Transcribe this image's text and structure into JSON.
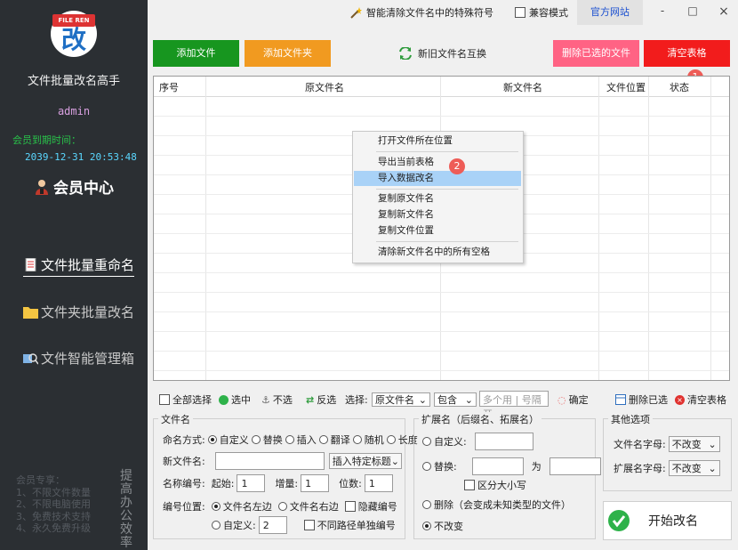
{
  "sidebar": {
    "logo_badge": "FILE REN",
    "logo_char": "改",
    "app_title": "文件批量改名高手",
    "username": "admin",
    "expiry_label": "会员到期时间：",
    "expiry_date": "2039-12-31 20:53:48",
    "vip_center": "会员中心",
    "nav": [
      {
        "label": "文件批量重命名",
        "icon": "document-icon"
      },
      {
        "label": "文件夹批量改名",
        "icon": "folder-icon"
      },
      {
        "label": "文件智能管理箱",
        "icon": "search-files-icon"
      }
    ],
    "vip_title": "会员专享：",
    "vip_benefits": [
      "1、不限文件数量",
      "2、不限电脑使用",
      "3、免费技术支持",
      "4、永久免费升级"
    ],
    "slogan": "提高办公效率"
  },
  "topbar": {
    "clean_label": "智能清除文件名中的特殊符号",
    "compat_label": "兼容模式",
    "website_label": "官方网站",
    "minimize": "-",
    "maximize": "□",
    "close": "×"
  },
  "toolbar": {
    "add_file": "添加文件",
    "add_folder": "添加文件夹",
    "swap_names": "新旧文件名互换",
    "delete_selected": "删除已选的文件",
    "clear_table": "清空表格",
    "colors": {
      "add_file": "#17961f",
      "add_folder": "#f19a20",
      "delete_selected": "#ff6384",
      "clear_table": "#f21c1c"
    }
  },
  "table": {
    "columns": [
      "序号",
      "原文件名",
      "新文件名",
      "文件位置",
      "状态"
    ]
  },
  "context_menu": {
    "items": [
      "打开文件所在位置",
      "导出当前表格",
      "导入数据改名",
      "复制原文件名",
      "复制新文件名",
      "复制文件位置",
      "清除新文件名中的所有空格"
    ],
    "highlighted": "导入数据改名"
  },
  "markers": {
    "one": "1",
    "two": "2"
  },
  "selection_bar": {
    "select_all": "全部选择",
    "select": "选中",
    "deselect": "不选",
    "invert": "反选",
    "choose_label": "选择:",
    "field": "原文件名",
    "match": "包含",
    "input_placeholder": "多个用 | 号隔开",
    "confirm": "确定",
    "delete_selected": "删除已选",
    "clear_table": "清空表格"
  },
  "filename_panel": {
    "title": "文件名",
    "mode_label": "命名方式:",
    "modes": [
      "自定义",
      "替换",
      "插入",
      "翻译",
      "随机",
      "长度"
    ],
    "new_name_label": "新文件名:",
    "insert_title": "插入特定标题",
    "number_label": "名称编号:",
    "start_label": "起始:",
    "start_value": "1",
    "increment_label": "增量:",
    "increment_value": "1",
    "digits_label": "位数:",
    "digits_value": "1",
    "position_label": "编号位置:",
    "pos_left": "文件名左边",
    "pos_right": "文件名右边",
    "hide_number": "隐藏编号",
    "custom": "自定义:",
    "custom_value": "2",
    "separate_path": "不同路径单独编号"
  },
  "ext_panel": {
    "title": "扩展名（后缀名、拓展名）",
    "custom": "自定义:",
    "replace": "替换:",
    "to": "为",
    "case_sensitive": "区分大小写",
    "delete": "删除（会变成未知类型的文件）",
    "unchanged": "不改变"
  },
  "other_panel": {
    "title": "其他选项",
    "filename_case_label": "文件名字母:",
    "filename_case": "不改变",
    "ext_case_label": "扩展名字母:",
    "ext_case": "不改变"
  },
  "start_button": "开始改名"
}
